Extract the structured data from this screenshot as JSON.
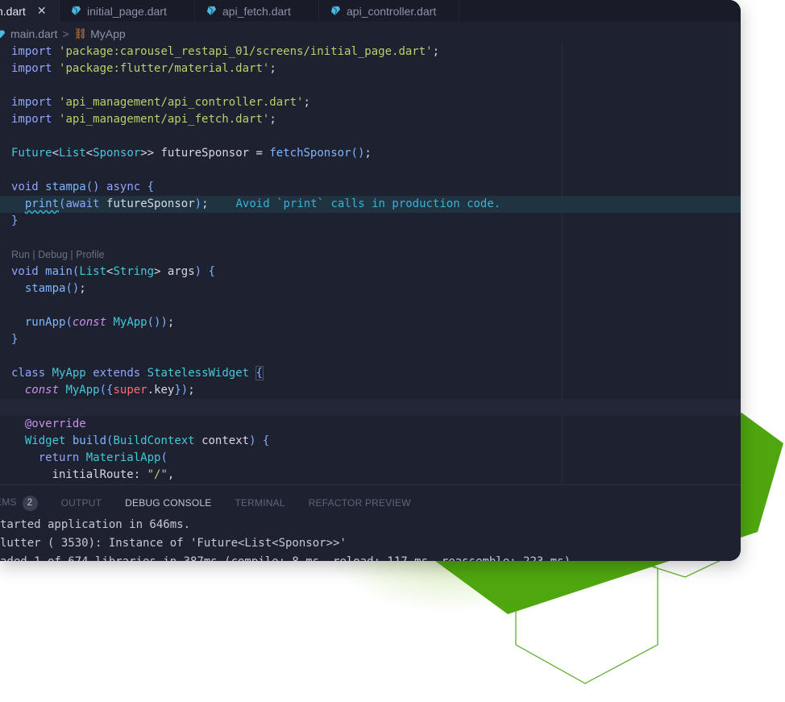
{
  "tabs": [
    {
      "label": "h.dart",
      "active": true,
      "close": "✕"
    },
    {
      "label": "initial_page.dart",
      "active": false
    },
    {
      "label": "api_fetch.dart",
      "active": false
    },
    {
      "label": "api_controller.dart",
      "active": false
    }
  ],
  "breadcrumb": {
    "file": "main.dart",
    "separator": ">",
    "symbol": "MyApp"
  },
  "code": {
    "l1": {
      "kw": "import",
      "str": "'package:carousel_restapi_01/screens/initial_page.dart'",
      "end": ";"
    },
    "l2": {
      "kw": "import",
      "str": "'package:flutter/material.dart'",
      "end": ";"
    },
    "l4": {
      "kw": "import",
      "str": "'api_management/api_controller.dart'",
      "end": ";"
    },
    "l5": {
      "kw": "import",
      "str": "'api_management/api_fetch.dart'",
      "end": ";"
    },
    "l7": {
      "t1": "Future",
      "t2": "List",
      "t3": "Sponsor",
      "var": "futureSponsor",
      "fn": "fetchSponsor"
    },
    "l9": {
      "kw": "void",
      "fn": "stampa",
      "kw2": "async"
    },
    "l10": {
      "fn": "print",
      "kw": "await",
      "var": "futureSponsor",
      "lint": "Avoid `print` calls in production code."
    },
    "codelens": "Run | Debug | Profile",
    "l13": {
      "kw": "void",
      "fn": "main",
      "t1": "List",
      "t2": "String",
      "var": "args"
    },
    "l14": {
      "fn": "stampa"
    },
    "l16": {
      "fn": "runApp",
      "kw2": "const",
      "type": "MyApp"
    },
    "l19": {
      "kw": "class",
      "type": "MyApp",
      "kw2": "extends",
      "type2": "StatelessWidget"
    },
    "l20": {
      "kw2": "const",
      "type": "MyApp",
      "sup": "super",
      "var": "key"
    },
    "l22": {
      "ann": "@override"
    },
    "l23": {
      "type": "Widget",
      "fn": "build",
      "type2": "BuildContext",
      "var": "context"
    },
    "l24": {
      "kw": "return",
      "type": "MaterialApp"
    },
    "l25": {
      "var": "initialRoute",
      "str": "\"/\""
    }
  },
  "panel": {
    "tabs": [
      "EMS",
      "OUTPUT",
      "DEBUG CONSOLE",
      "TERMINAL",
      "REFACTOR PREVIEW"
    ],
    "problem_count": "2",
    "active_tab": "DEBUG CONSOLE",
    "console": [
      "tarted application in 646ms.",
      "lutter ( 3530): Instance of 'Future<List<Sponsor>>'",
      "aded 1 of 674 libraries in 387ms (compile: 8 ms, reload: 117 ms, reassemble: 223 ms)."
    ]
  },
  "colors": {
    "accent_green": "#4fa70f",
    "editor_bg": "#1e2130",
    "keyword": "#8fa6ff",
    "string": "#b5d36b",
    "type": "#45c8d9"
  }
}
